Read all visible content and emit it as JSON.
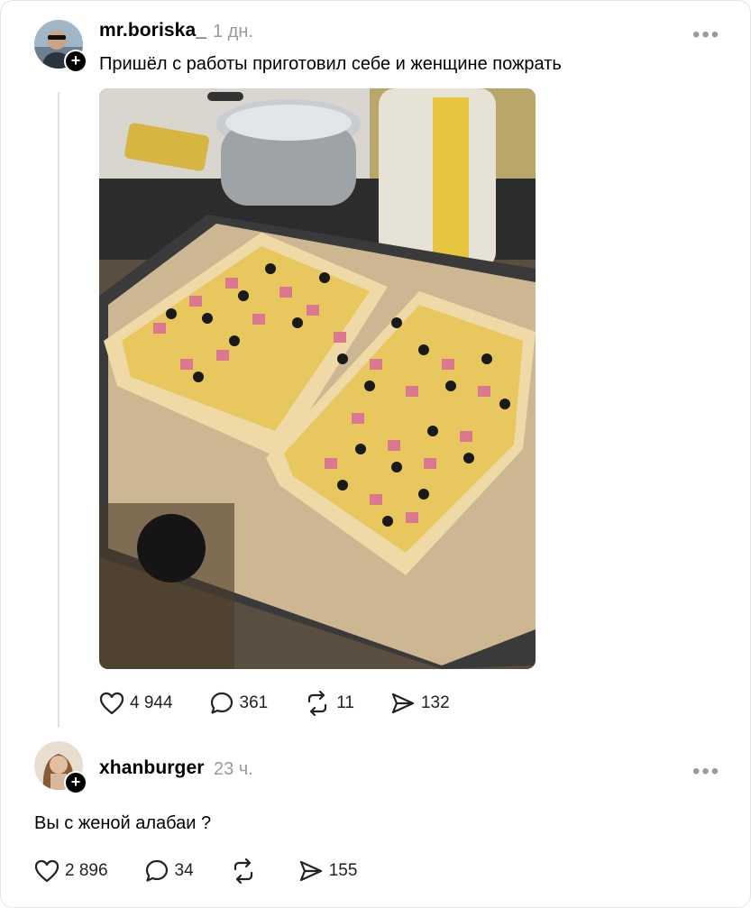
{
  "posts": [
    {
      "username": "mr.boriska_",
      "time": "1 дн.",
      "text": "Пришёл с работы приготовил себе и женщине пожрать",
      "actions": {
        "likes": "4 944",
        "comments": "361",
        "reposts": "11",
        "shares": "132"
      }
    },
    {
      "username": "xhanburger",
      "time": "23 ч.",
      "text": "Вы с женой алабаи ?",
      "actions": {
        "likes": "2 896",
        "comments": "34",
        "reposts": "",
        "shares": "155"
      }
    }
  ],
  "icons": {
    "like": "heart-icon",
    "comment": "comment-bubble-icon",
    "repost": "repost-icon",
    "share": "send-icon",
    "more": "more-dots-icon",
    "follow": "plus-icon"
  },
  "colors": {
    "muted": "#9a9a9a",
    "thread_line": "#e0e0e0",
    "border": "#e4e4e4"
  }
}
